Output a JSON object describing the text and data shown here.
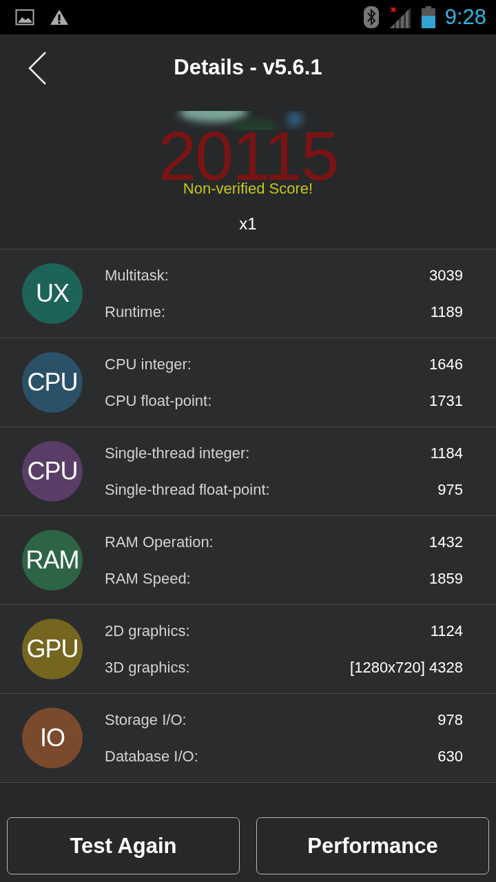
{
  "status_bar": {
    "time": "9:28"
  },
  "header": {
    "title": "Details - v5.6.1"
  },
  "score": {
    "value": "20115",
    "note": "Non-verified Score!",
    "multiplier": "x1"
  },
  "sections": [
    {
      "badge": "UX",
      "color": "#1e6358",
      "items": [
        {
          "label": "Multitask:",
          "value": "3039"
        },
        {
          "label": "Runtime:",
          "value": "1189"
        }
      ]
    },
    {
      "badge": "CPU",
      "color": "#2b5169",
      "items": [
        {
          "label": "CPU integer:",
          "value": "1646"
        },
        {
          "label": "CPU float-point:",
          "value": "1731"
        }
      ]
    },
    {
      "badge": "CPU",
      "color": "#5a3d66",
      "items": [
        {
          "label": "Single-thread integer:",
          "value": "1184"
        },
        {
          "label": "Single-thread float-point:",
          "value": "975"
        }
      ]
    },
    {
      "badge": "RAM",
      "color": "#2e6446",
      "items": [
        {
          "label": "RAM Operation:",
          "value": "1432"
        },
        {
          "label": "RAM Speed:",
          "value": "1859"
        }
      ]
    },
    {
      "badge": "GPU",
      "color": "#75661f",
      "items": [
        {
          "label": "2D graphics:",
          "value": "1124"
        },
        {
          "label": "3D graphics:",
          "value": "[1280x720] 4328"
        }
      ]
    },
    {
      "badge": "IO",
      "color": "#7a4a2c",
      "items": [
        {
          "label": "Storage I/O:",
          "value": "978"
        },
        {
          "label": "Database I/O:",
          "value": "630"
        }
      ]
    }
  ],
  "buttons": [
    "Test Again",
    "Performance"
  ]
}
